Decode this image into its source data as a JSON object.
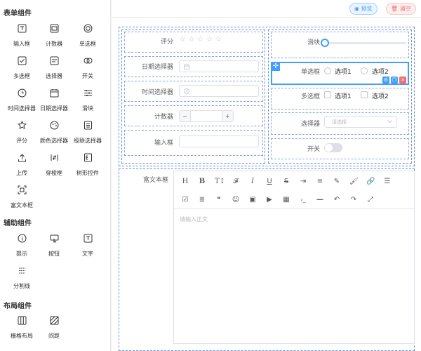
{
  "sidebar": {
    "sections": [
      {
        "title": "表单组件",
        "items": [
          "输入框",
          "计数器",
          "单选框",
          "多选框",
          "选择器",
          "开关",
          "时间选择器",
          "日期选择器",
          "滑块",
          "评分",
          "颜色选择器",
          "级联选择器",
          "上传",
          "穿梭框",
          "树形控件",
          "富文本框"
        ]
      },
      {
        "title": "辅助组件",
        "items": [
          "提示",
          "按钮",
          "文字",
          "分割线"
        ]
      },
      {
        "title": "布局组件",
        "items": [
          "栅格布局",
          "间距"
        ]
      }
    ]
  },
  "toolbar": {
    "preview_label": "预览",
    "clear_label": "清空"
  },
  "form": {
    "rating_label": "评分",
    "date_label": "日期选择器",
    "time_label": "时间选择器",
    "counter_label": "计数器",
    "counter_minus": "−",
    "counter_plus": "+",
    "input_label": "输入框",
    "slider_label": "滑块",
    "radio_label": "单选框",
    "radio_options": [
      "选项1",
      "选项2"
    ],
    "checkbox_label": "多选框",
    "checkbox_options": [
      "选项1",
      "选项2"
    ],
    "select_label": "选择器",
    "select_placeholder": "请选择",
    "switch_label": "开关",
    "richtext_label": "富文本框",
    "richtext_placeholder": "请输入正文"
  },
  "editor_toolbar": {
    "row1": [
      "H",
      "B",
      "T↕",
      "𝓕",
      "I",
      "U",
      "S",
      "⇥",
      "≡",
      "✎",
      "🖌",
      "🔗",
      "☰"
    ],
    "row2": [
      "☑",
      "≣",
      "❝",
      "☺",
      "▣",
      "▶",
      "▦",
      "›_",
      "—",
      "↶",
      "↷",
      "⤢"
    ]
  },
  "colors": {
    "accent": "#409eff",
    "danger": "#f56c6c",
    "dash": "#6c8fd6"
  }
}
